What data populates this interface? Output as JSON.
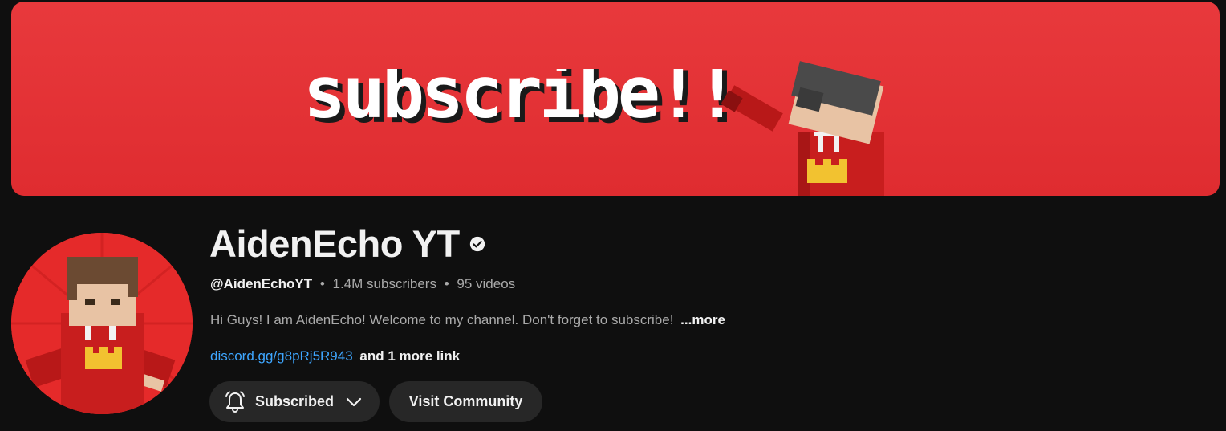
{
  "banner": {
    "text": "subscribe!!"
  },
  "channel": {
    "name": "AidenEcho YT",
    "handle": "@AidenEchoYT",
    "subscribers": "1.4M subscribers",
    "videos": "95 videos",
    "separator": "•",
    "description": "Hi Guys! I am AidenEcho! Welcome to my channel. Don't forget to subscribe!",
    "more_label": "...more",
    "link_text": "discord.gg/g8pRj5R943",
    "more_links": "and 1 more link"
  },
  "buttons": {
    "subscribed_label": "Subscribed",
    "community_label": "Visit Community"
  },
  "icons": {
    "verified": "verified-check-icon",
    "bell": "bell-icon",
    "chevron": "chevron-down-icon"
  },
  "colors": {
    "background": "#0f0f0f",
    "banner_red": "#e33436",
    "button_bg": "#272727",
    "link_blue": "#3ea6ff",
    "secondary_text": "#aaaaaa"
  }
}
